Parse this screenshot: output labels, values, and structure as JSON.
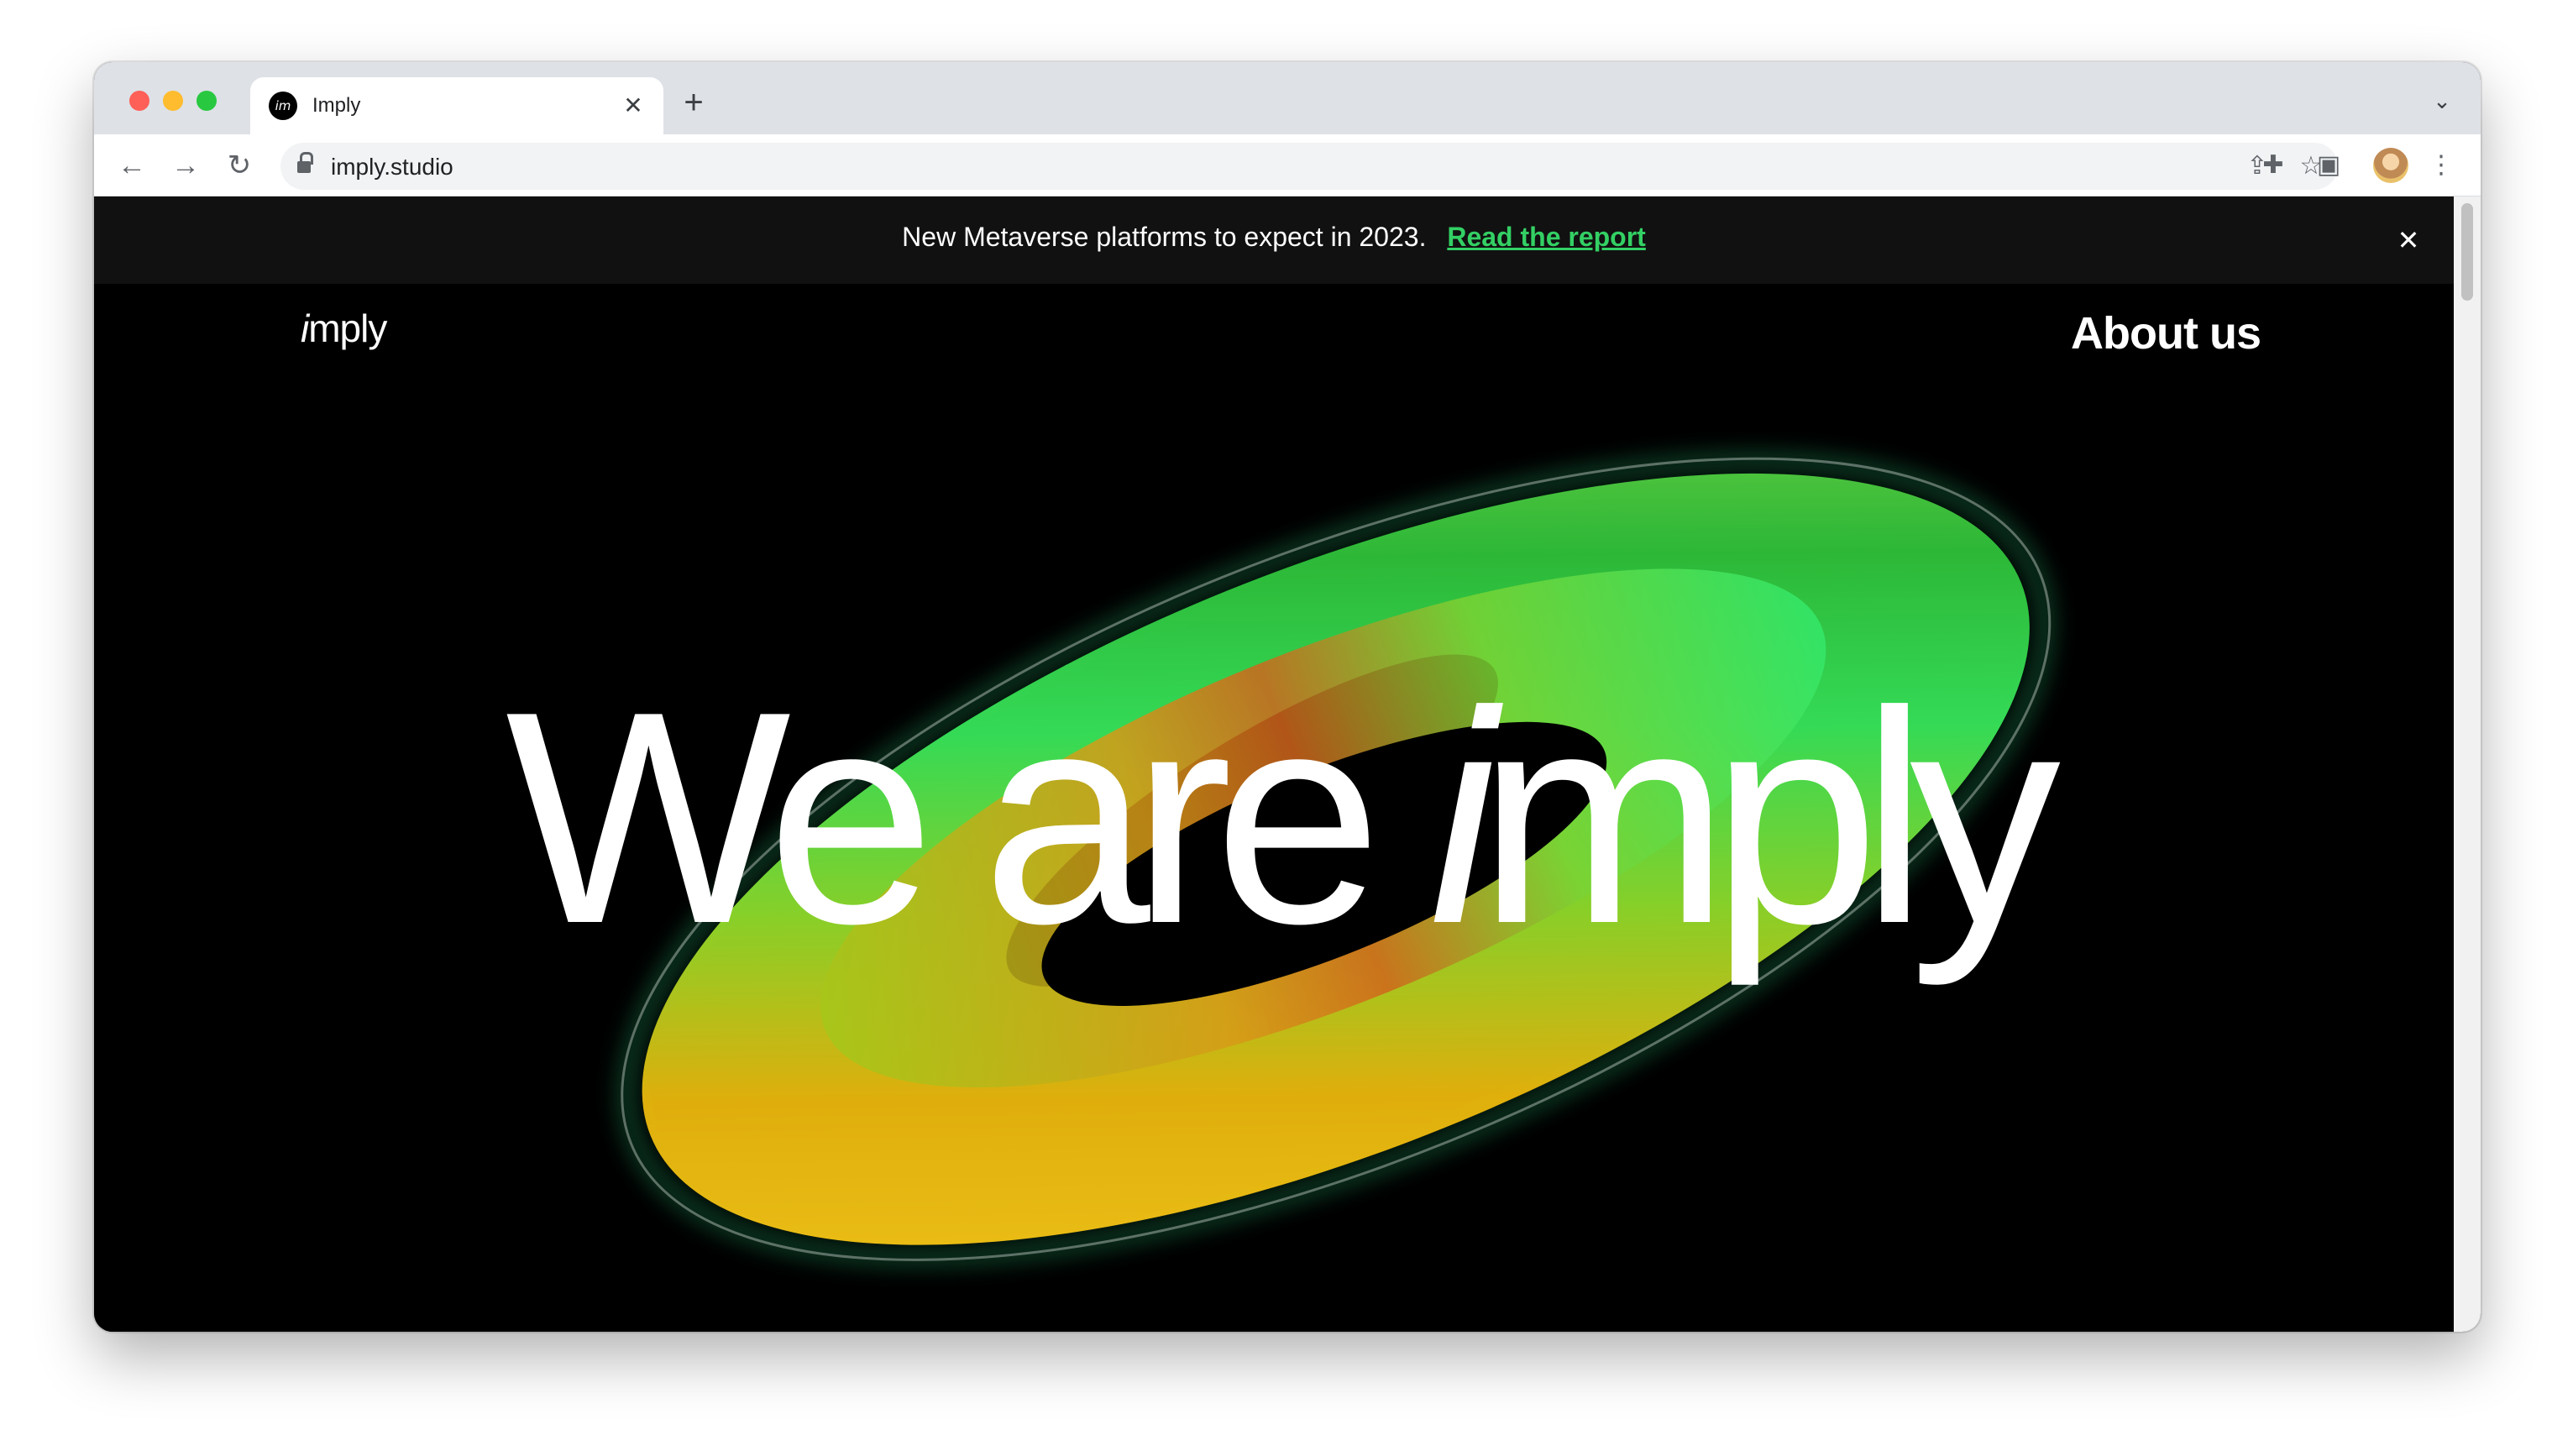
{
  "browser": {
    "tab_title": "Imply",
    "tab_favicon": "im",
    "url": "imply.studio",
    "icons": {
      "back": "back-arrow-icon",
      "forward": "forward-arrow-icon",
      "reload": "reload-icon",
      "lock": "lock-icon",
      "share": "share-icon",
      "bookmark": "star-icon",
      "extensions": "puzzle-icon",
      "side_panel": "side-panel-icon",
      "menu": "kebab-menu-icon",
      "tab_close": "close-icon",
      "new_tab": "plus-icon",
      "tab_search": "chevron-down-icon"
    }
  },
  "page": {
    "banner": {
      "text": "New Metaverse platforms to expect in 2023.",
      "link": "Read the report"
    },
    "logo": {
      "i": "i",
      "rest": "mply"
    },
    "nav": {
      "about": "About us"
    },
    "hero": {
      "prefix": "We are ",
      "emph": "i",
      "suffix": "mply"
    }
  },
  "colors": {
    "banner_bg": "#111111",
    "link_green": "#33d064",
    "page_bg": "#000000"
  }
}
